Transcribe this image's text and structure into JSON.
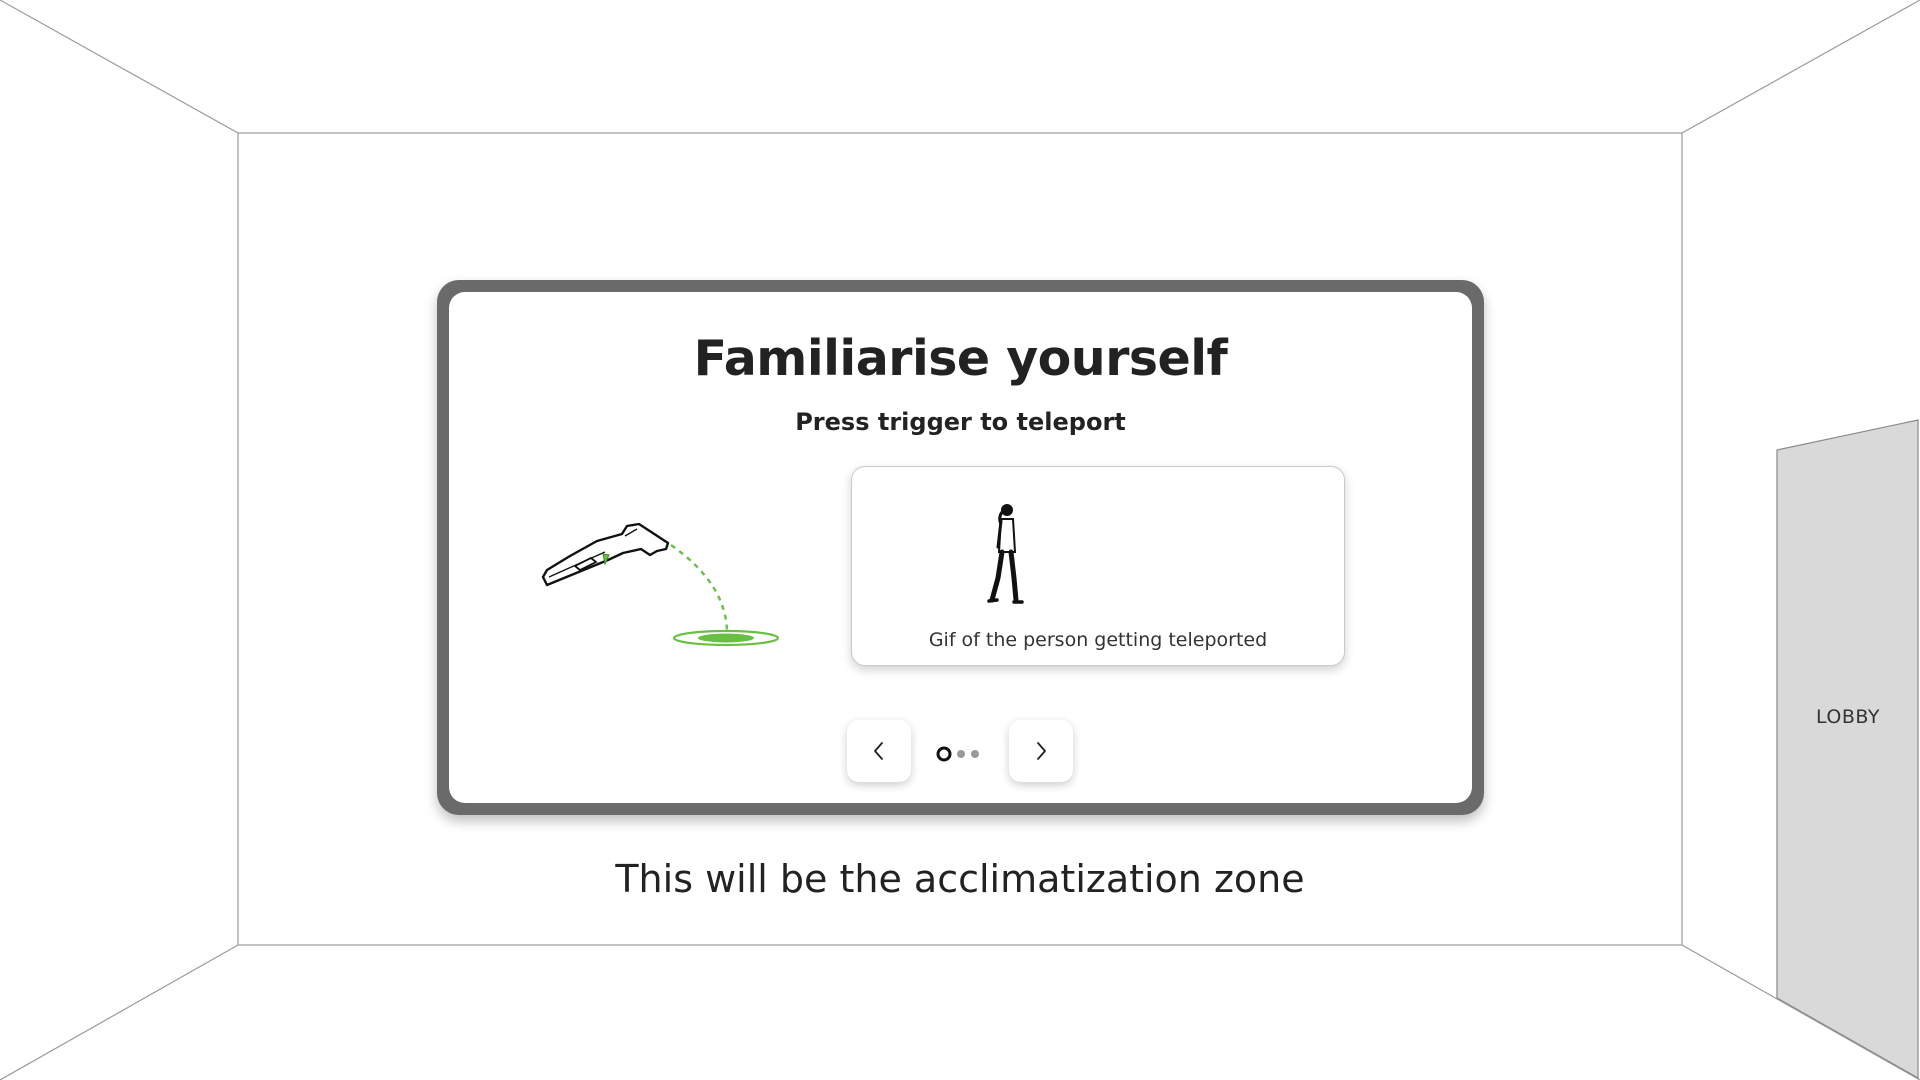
{
  "panel": {
    "title": "Familiarise yourself",
    "subtitle": "Press trigger to teleport",
    "gif_caption": "Gif of the person getting teleported",
    "pagination": {
      "current_page": 1,
      "total_pages": 3
    }
  },
  "zone_label": "This will be the acclimatization zone",
  "door": {
    "label": "LOBBY"
  },
  "colors": {
    "accent_green": "#69bf44",
    "panel_frame": "#6a6a6a",
    "door_fill": "#d9d9d9",
    "text": "#222222"
  },
  "icons": {
    "prev": "chevron-left-icon",
    "next": "chevron-right-icon",
    "controller": "vr-controller-icon",
    "teleport_target": "teleport-target-icon",
    "person": "walking-person-icon"
  }
}
